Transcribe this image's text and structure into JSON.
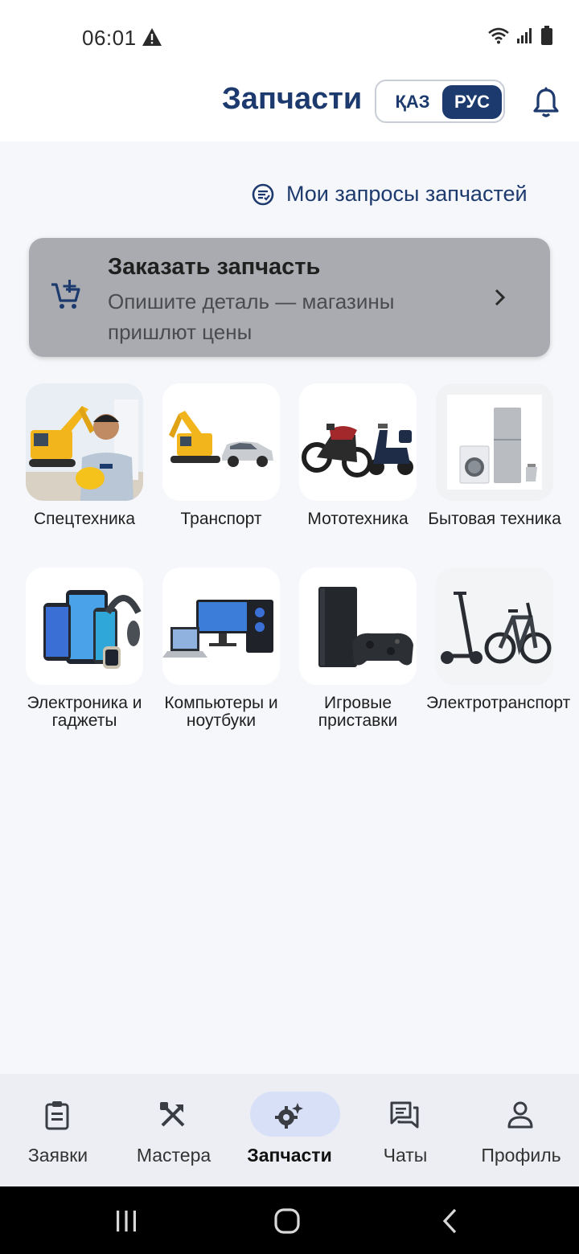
{
  "status_bar": {
    "time": "06:01"
  },
  "header": {
    "title": "Запчасти",
    "lang_kaz": "ҚАЗ",
    "lang_rus": "РУС",
    "active_lang": "РУС"
  },
  "requests_link": {
    "label": "Мои запросы запчастей"
  },
  "order_card": {
    "title": "Заказать запчасть",
    "subtitle": "Опишите деталь — магазины пришлют цены"
  },
  "categories": [
    {
      "label": "Спецтехника",
      "icon": "excavator-worker-image"
    },
    {
      "label": "Транспорт",
      "icon": "excavator-car-image"
    },
    {
      "label": "Мототехника",
      "icon": "motorcycle-scooter-image"
    },
    {
      "label": "Бытовая техника",
      "icon": "home-appliances-image"
    },
    {
      "label": "Электроника и гаджеты",
      "icon": "gadgets-image"
    },
    {
      "label": "Компьютеры и ноутбуки",
      "icon": "computers-image"
    },
    {
      "label": "Игровые приставки",
      "icon": "game-console-image"
    },
    {
      "label": "Электротранспорт",
      "icon": "electric-transport-image"
    }
  ],
  "bottom_nav": {
    "items": [
      {
        "label": "Заявки",
        "icon": "clipboard-icon"
      },
      {
        "label": "Мастера",
        "icon": "tools-icon"
      },
      {
        "label": "Запчасти",
        "icon": "gear-sparkle-icon"
      },
      {
        "label": "Чаты",
        "icon": "chat-icon"
      },
      {
        "label": "Профиль",
        "icon": "person-icon"
      }
    ],
    "active": "Запчасти"
  },
  "colors": {
    "brand": "#1d3a6e",
    "background": "#f6f7fa",
    "card_gray": "#a9abb0",
    "nav_active": "#d7e0f7"
  }
}
